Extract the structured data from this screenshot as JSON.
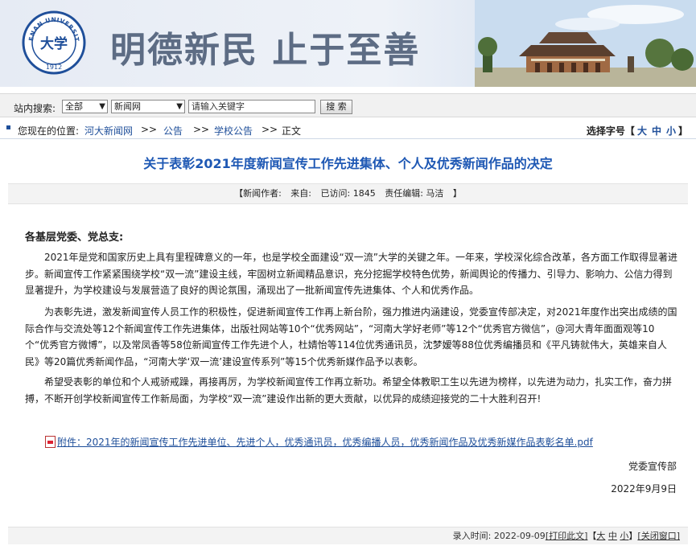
{
  "header": {
    "motto": "明德新民 止于至善",
    "logo_text_top": "HENAN UNIVERSITY",
    "logo_year": "1912",
    "logo_center": "大学"
  },
  "search": {
    "label": "站内搜索:",
    "scope": "全部",
    "site": "新闻网",
    "placeholder": "请输入关键字",
    "button": "搜 索"
  },
  "breadcrumb": {
    "prefix": "您现在的位置:",
    "items": [
      "河大新闻网",
      "公告",
      "学校公告",
      "正文"
    ],
    "sep": ">>",
    "font_label": "选择字号【",
    "font_sizes": [
      "大",
      "中",
      "小"
    ],
    "font_end": "】"
  },
  "article": {
    "title": "关于表彰2021年度新闻宣传工作先进集体、个人及优秀新闻作品的决定",
    "meta": {
      "open": "【新闻作者:",
      "source": "来自:",
      "visits": "已访问: 1845",
      "editor": "责任编辑: 马洁",
      "close": "】"
    },
    "salutation": "各基层党委、党总支:",
    "paragraphs": [
      "2021年是党和国家历史上具有里程碑意义的一年，也是学校全面建设“双一流”大学的关键之年。一年来，学校深化综合改革，各方面工作取得显著进步。新闻宣传工作紧紧围绕学校“双一流”建设主线，牢固树立新闻精品意识，充分挖掘学校特色优势，新闻舆论的传播力、引导力、影响力、公信力得到显著提升，为学校建设与发展营造了良好的舆论氛围，涌现出了一批新闻宣传先进集体、个人和优秀作品。",
      "为表彰先进，激发新闻宣传人员工作的积极性，促进新闻宣传工作再上新台阶，强力推进内涵建设，党委宣传部决定，对2021年度作出突出成绩的国际合作与交流处等12个新闻宣传工作先进集体，出版社网站等10个“优秀网站”，“河南大学好老师”等12个“优秀官方微信”，@河大青年面面观等10个“优秀官方微博”，以及常凤香等58位新闻宣传工作先进个人，杜婧怡等114位优秀通讯员，沈梦嫒等88位优秀编播员和《平凡铸就伟大，英雄来自人民》等20篇优秀新闻作品，“河南大学‘双一流’建设宣传系列”等15个优秀新媒作品予以表彰。",
      "希望受表彰的单位和个人戒骄戒躁，再接再厉，为学校新闻宣传工作再立新功。希望全体教职工生以先进为榜样，以先进为动力，扎实工作，奋力拼搏，不断开创学校新闻宣传工作新局面，为学校“双一流”建设作出新的更大贡献，以优异的成绩迎接党的二十大胜利召开!"
    ],
    "attachment": "附件：2021年的新闻宣传工作先进单位、先进个人，优秀通讯员，优秀编播人员，优秀新闻作品及优秀新媒作品表彰名单.pdf",
    "signature": "党委宣传部",
    "date": "2022年9月9日"
  },
  "footer": {
    "record_time": "录入时间: 2022-09-09",
    "print": "[打印此文]",
    "size_open": "【",
    "sizes": [
      "大",
      "中",
      "小"
    ],
    "size_close": "】",
    "close": "[关闭窗口]"
  },
  "colors": {
    "title": "#1e58b4",
    "link": "#1f4f9a"
  }
}
